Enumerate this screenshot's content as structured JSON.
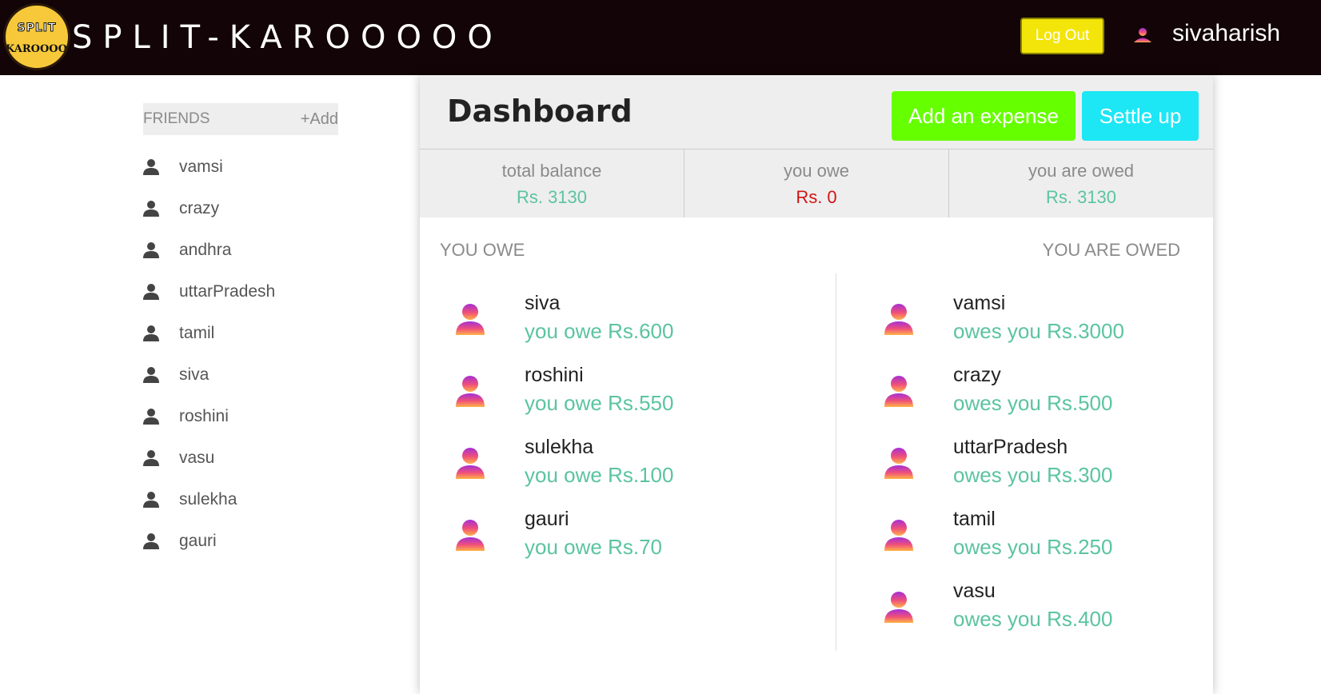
{
  "header": {
    "logo_line1": "SPLIT",
    "logo_line2": "KAROOOOO",
    "brand": "SPLIT-KAROOOOO",
    "logout_label": "Log Out",
    "username": "sivaharish"
  },
  "sidebar": {
    "title": "FRIENDS",
    "add_label": "+Add",
    "friends": [
      {
        "name": "vamsi"
      },
      {
        "name": "crazy"
      },
      {
        "name": "andhra"
      },
      {
        "name": "uttarPradesh"
      },
      {
        "name": "tamil"
      },
      {
        "name": "siva"
      },
      {
        "name": "roshini"
      },
      {
        "name": "vasu"
      },
      {
        "name": "sulekha"
      },
      {
        "name": "gauri"
      }
    ]
  },
  "dashboard": {
    "title": "Dashboard",
    "add_expense_label": "Add an expense",
    "settle_up_label": "Settle up",
    "totals": [
      {
        "label": "total balance",
        "value": "Rs. 3130",
        "color": "#5bc49f"
      },
      {
        "label": "you owe",
        "value": "Rs. 0",
        "color": "#d21414"
      },
      {
        "label": "you are owed",
        "value": "Rs. 3130",
        "color": "#5bc49f"
      }
    ],
    "you_owe_title": "YOU OWE",
    "you_are_owed_title": "YOU ARE OWED",
    "you_owe": [
      {
        "name": "siva",
        "amount": "you owe Rs.600"
      },
      {
        "name": "roshini",
        "amount": "you owe Rs.550"
      },
      {
        "name": "sulekha",
        "amount": "you owe Rs.100"
      },
      {
        "name": "gauri",
        "amount": "you owe Rs.70"
      }
    ],
    "you_are_owed": [
      {
        "name": "vamsi",
        "amount": "owes you Rs.3000"
      },
      {
        "name": "crazy",
        "amount": "owes you Rs.500"
      },
      {
        "name": "uttarPradesh",
        "amount": "owes you Rs.300"
      },
      {
        "name": "tamil",
        "amount": "owes you Rs.250"
      },
      {
        "name": "vasu",
        "amount": "owes you Rs.400"
      }
    ]
  },
  "colors": {
    "header_bg": "#120407",
    "logout_bg": "#f3e50a",
    "add_expense_bg": "#66ff00",
    "settle_up_bg": "#1de6f5",
    "positive": "#5bc49f",
    "negative": "#d21414"
  },
  "icons": {
    "friend": "person-icon",
    "entry": "gradient-avatar-icon"
  }
}
